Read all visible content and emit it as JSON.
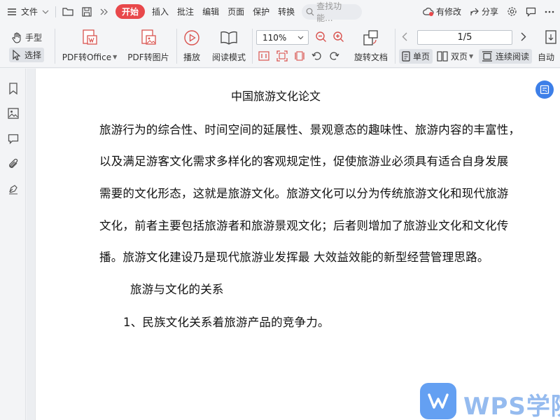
{
  "menubar": {
    "file_label": "文件",
    "tabs": [
      "开始",
      "插入",
      "批注",
      "编辑",
      "页面",
      "保护",
      "转换"
    ],
    "search_placeholder": "查找功能...",
    "modified_label": "有修改",
    "share_label": "分享"
  },
  "toolbar": {
    "hand_label": "手型",
    "select_label": "选择",
    "pdf_to_office_label": "PDF转Office",
    "pdf_to_image_label": "PDF转图片",
    "play_label": "播放",
    "reading_mode_label": "阅读模式",
    "zoom_value": "110%",
    "rotate_doc_label": "旋转文档",
    "page_value": "1/5",
    "single_page_label": "单页",
    "double_page_label": "双页",
    "continuous_label": "连续阅读",
    "auto_scroll_label": "自动"
  },
  "document": {
    "title": "中国旅游文化论文",
    "lines": [
      "旅游行为的综合性、时间空间的延展性、景观意态的趣味性、旅游内容的丰富性，",
      "以及满足游客文化需求多样化的客观规定性，促使旅游业必须具有适合自身发展",
      "需要的文化形态，这就是旅游文化。旅游文化可以分为传统旅游文化和现代旅游",
      "文化，前者主要包括旅游者和旅游景观文化；后者则增加了旅游业文化和文化传",
      "播。旅游文化建设乃是现代旅游业发挥最  大效益效能的新型经营管理思路。"
    ],
    "subheading": "旅游与文化的关系",
    "list_item": "1、民族文化关系着旅游产品的竞争力。"
  },
  "watermark": {
    "text": "WPS学院"
  },
  "colors": {
    "accent_red": "#e8484b",
    "accent_blue": "#3d7fe8"
  }
}
